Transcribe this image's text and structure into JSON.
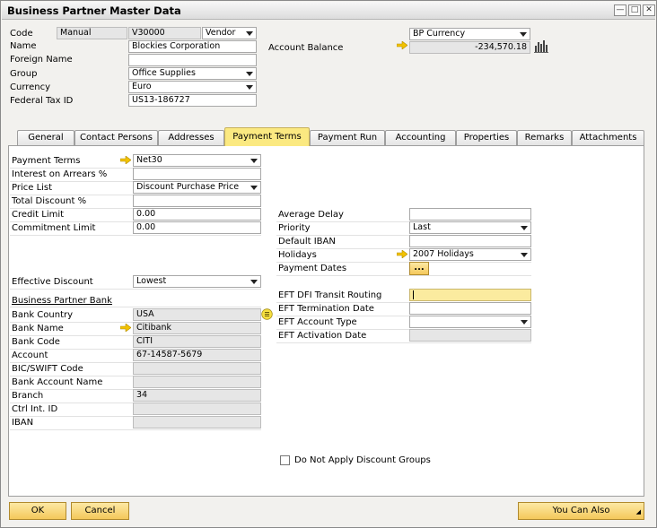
{
  "window": {
    "title": "Business Partner Master Data"
  },
  "header": {
    "code_label": "Code",
    "code_series": "Manual",
    "code_value": "V30000",
    "code_type": "Vendor",
    "name_label": "Name",
    "name_value": "Blockies Corporation",
    "foreign_name_label": "Foreign Name",
    "foreign_name_value": "",
    "group_label": "Group",
    "group_value": "Office Supplies",
    "currency_label": "Currency",
    "currency_value": "Euro",
    "tax_label": "Federal Tax ID",
    "tax_value": "US13-186727",
    "bp_currency": "BP Currency",
    "balance_label": "Account Balance",
    "balance_value": "-234,570.18"
  },
  "tabs": [
    {
      "label": "General"
    },
    {
      "label": "Contact Persons"
    },
    {
      "label": "Addresses"
    },
    {
      "label": "Payment Terms"
    },
    {
      "label": "Payment Run"
    },
    {
      "label": "Accounting"
    },
    {
      "label": "Properties"
    },
    {
      "label": "Remarks"
    },
    {
      "label": "Attachments"
    }
  ],
  "payment": {
    "terms_label": "Payment Terms",
    "terms_value": "Net30",
    "interest_label": "Interest on Arrears %",
    "interest_value": "",
    "price_list_label": "Price List",
    "price_list_value": "Discount Purchase Price",
    "total_discount_label": "Total Discount %",
    "total_discount_value": "",
    "credit_limit_label": "Credit Limit",
    "credit_limit_value": "0.00",
    "commitment_limit_label": "Commitment Limit",
    "commitment_limit_value": "0.00",
    "effective_discount_label": "Effective Discount",
    "effective_discount_value": "Lowest",
    "bp_bank_label": "Business Partner Bank",
    "bank_country_label": "Bank Country",
    "bank_country_value": "USA",
    "bank_name_label": "Bank Name",
    "bank_name_value": "Citibank",
    "bank_code_label": "Bank Code",
    "bank_code_value": "CITI",
    "account_label": "Account",
    "account_value": "67-14587-5679",
    "bic_label": "BIC/SWIFT Code",
    "bic_value": "",
    "bank_account_name_label": "Bank Account Name",
    "bank_account_name_value": "",
    "branch_label": "Branch",
    "branch_value": "34",
    "ctrl_label": "Ctrl Int. ID",
    "ctrl_value": "",
    "iban_label": "IBAN",
    "iban_value": "",
    "avg_delay_label": "Average Delay",
    "avg_delay_value": "",
    "priority_label": "Priority",
    "priority_value": "Last",
    "default_iban_label": "Default IBAN",
    "default_iban_value": "",
    "holidays_label": "Holidays",
    "holidays_value": "2007 Holidays",
    "payment_dates_label": "Payment Dates",
    "payment_dates_button": "...",
    "eft_dfi_label": "EFT DFI Transit Routing",
    "eft_dfi_value": "",
    "eft_term_label": "EFT Termination Date",
    "eft_term_value": "",
    "eft_type_label": "EFT Account Type",
    "eft_type_value": "",
    "eft_act_label": "EFT Activation Date",
    "eft_act_value": "",
    "no_discount_label": "Do Not Apply Discount Groups"
  },
  "footer": {
    "ok": "OK",
    "cancel": "Cancel",
    "you_can_also": "You Can Also"
  },
  "colors": {
    "active_tab": "#fbe981",
    "button": "#f4c85b",
    "link_arrow": "#f2c200"
  }
}
